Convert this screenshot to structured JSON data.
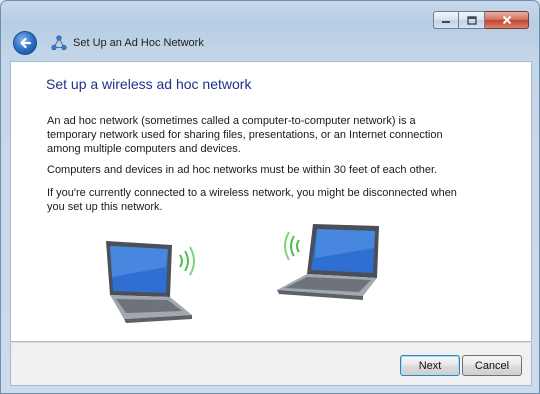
{
  "window": {
    "title": "Set Up an Ad Hoc Network",
    "controls": [
      "minimize-icon",
      "maximize-icon",
      "close-icon"
    ]
  },
  "header": {
    "back_icon": "back-arrow-icon",
    "network_icon": "adhoc-network-icon"
  },
  "content": {
    "heading": "Set up a wireless ad hoc network",
    "paragraphs": [
      "An ad hoc network (sometimes called a computer-to-computer network) is a temporary network used for sharing files, presentations, or an Internet connection among multiple computers and devices.",
      "Computers and devices in ad hoc networks must be within 30 feet of each other.",
      "If you're currently connected to a wireless network, you might be disconnected when you set up this network."
    ],
    "illustration": [
      "laptop-icon",
      "laptop-icon"
    ]
  },
  "footer": {
    "next_label": "Next",
    "cancel_label": "Cancel"
  },
  "colors": {
    "heading": "#1e3287",
    "frame": "#c4d6e9",
    "accent": "#2a6bc1"
  }
}
